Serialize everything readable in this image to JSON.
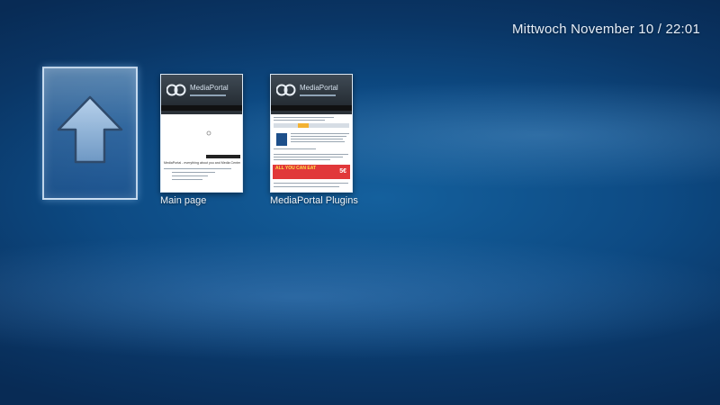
{
  "clock": {
    "text": "Mittwoch November 10 / 22:01"
  },
  "up_tile": {
    "icon": "arrow-up-icon"
  },
  "items": [
    {
      "label": "Main page",
      "thumb_brand": "MediaPortal",
      "thumb_title": "MediaPortal - everything about you and Media Center"
    },
    {
      "label": "MediaPortal Plugins",
      "thumb_brand": "MediaPortal",
      "thumb_banner_text": "ALL YOU CAN EAT",
      "thumb_banner_price": "5€"
    }
  ],
  "colors": {
    "background": "#0d4a83",
    "text": "#e6eef8",
    "banner": "#e1383a"
  }
}
